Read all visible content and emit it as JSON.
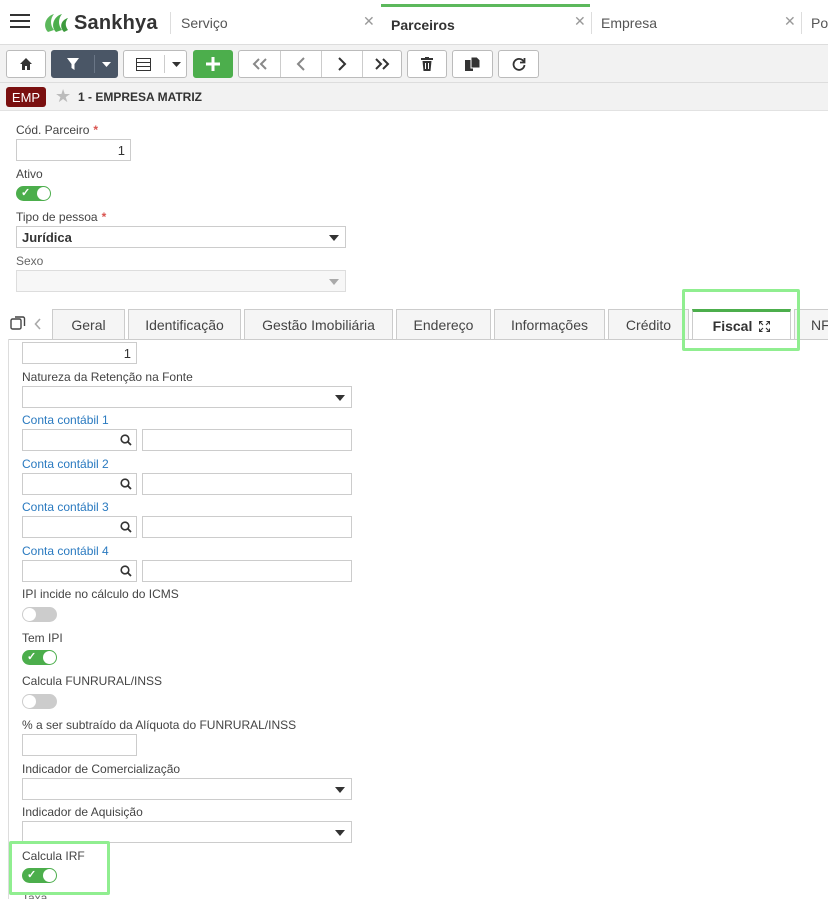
{
  "app": {
    "brand": "Sankhya"
  },
  "top_tabs": [
    {
      "label": "Serviço"
    },
    {
      "label": "Parceiros"
    },
    {
      "label": "Empresa"
    },
    {
      "label": "Po"
    }
  ],
  "breadcrumb": {
    "badge": "EMP",
    "title": "1 - EMPRESA MATRIZ"
  },
  "form": {
    "cod_parceiro_label": "Cód. Parceiro",
    "cod_parceiro_value": "1",
    "ativo_label": "Ativo",
    "tipo_pessoa_label": "Tipo de pessoa",
    "tipo_pessoa_value": "Jurídica",
    "sexo_label": "Sexo",
    "required_mark": "*"
  },
  "form_tabs": [
    {
      "label": "Geral"
    },
    {
      "label": "Identificação"
    },
    {
      "label": "Gestão Imobiliária"
    },
    {
      "label": "Endereço"
    },
    {
      "label": "Informações"
    },
    {
      "label": "Crédito"
    },
    {
      "label": "Fiscal"
    },
    {
      "label": "NF"
    }
  ],
  "fiscal": {
    "top_value": "1",
    "natureza_label": "Natureza da Retenção na Fonte",
    "conta1_label": "Conta contábil 1",
    "conta2_label": "Conta contábil 2",
    "conta3_label": "Conta contábil 3",
    "conta4_label": "Conta contábil 4",
    "ipi_icms_label": "IPI incide no cálculo do ICMS",
    "tem_ipi_label": "Tem IPI",
    "funrural_label": "Calcula FUNRURAL/INSS",
    "percent_label": "% a ser subtraído da Alíquota do FUNRURAL/INSS",
    "ind_comerc_label": "Indicador de Comercialização",
    "ind_aquis_label": "Indicador de Aquisição",
    "calcula_irf_label": "Calcula IRF",
    "bottom_cut_label": "Taxa"
  },
  "colors": {
    "accent_green": "#4cae4c",
    "highlight": "#90ee90",
    "link_blue": "#2a7ac0",
    "badge": "#7a1010"
  }
}
